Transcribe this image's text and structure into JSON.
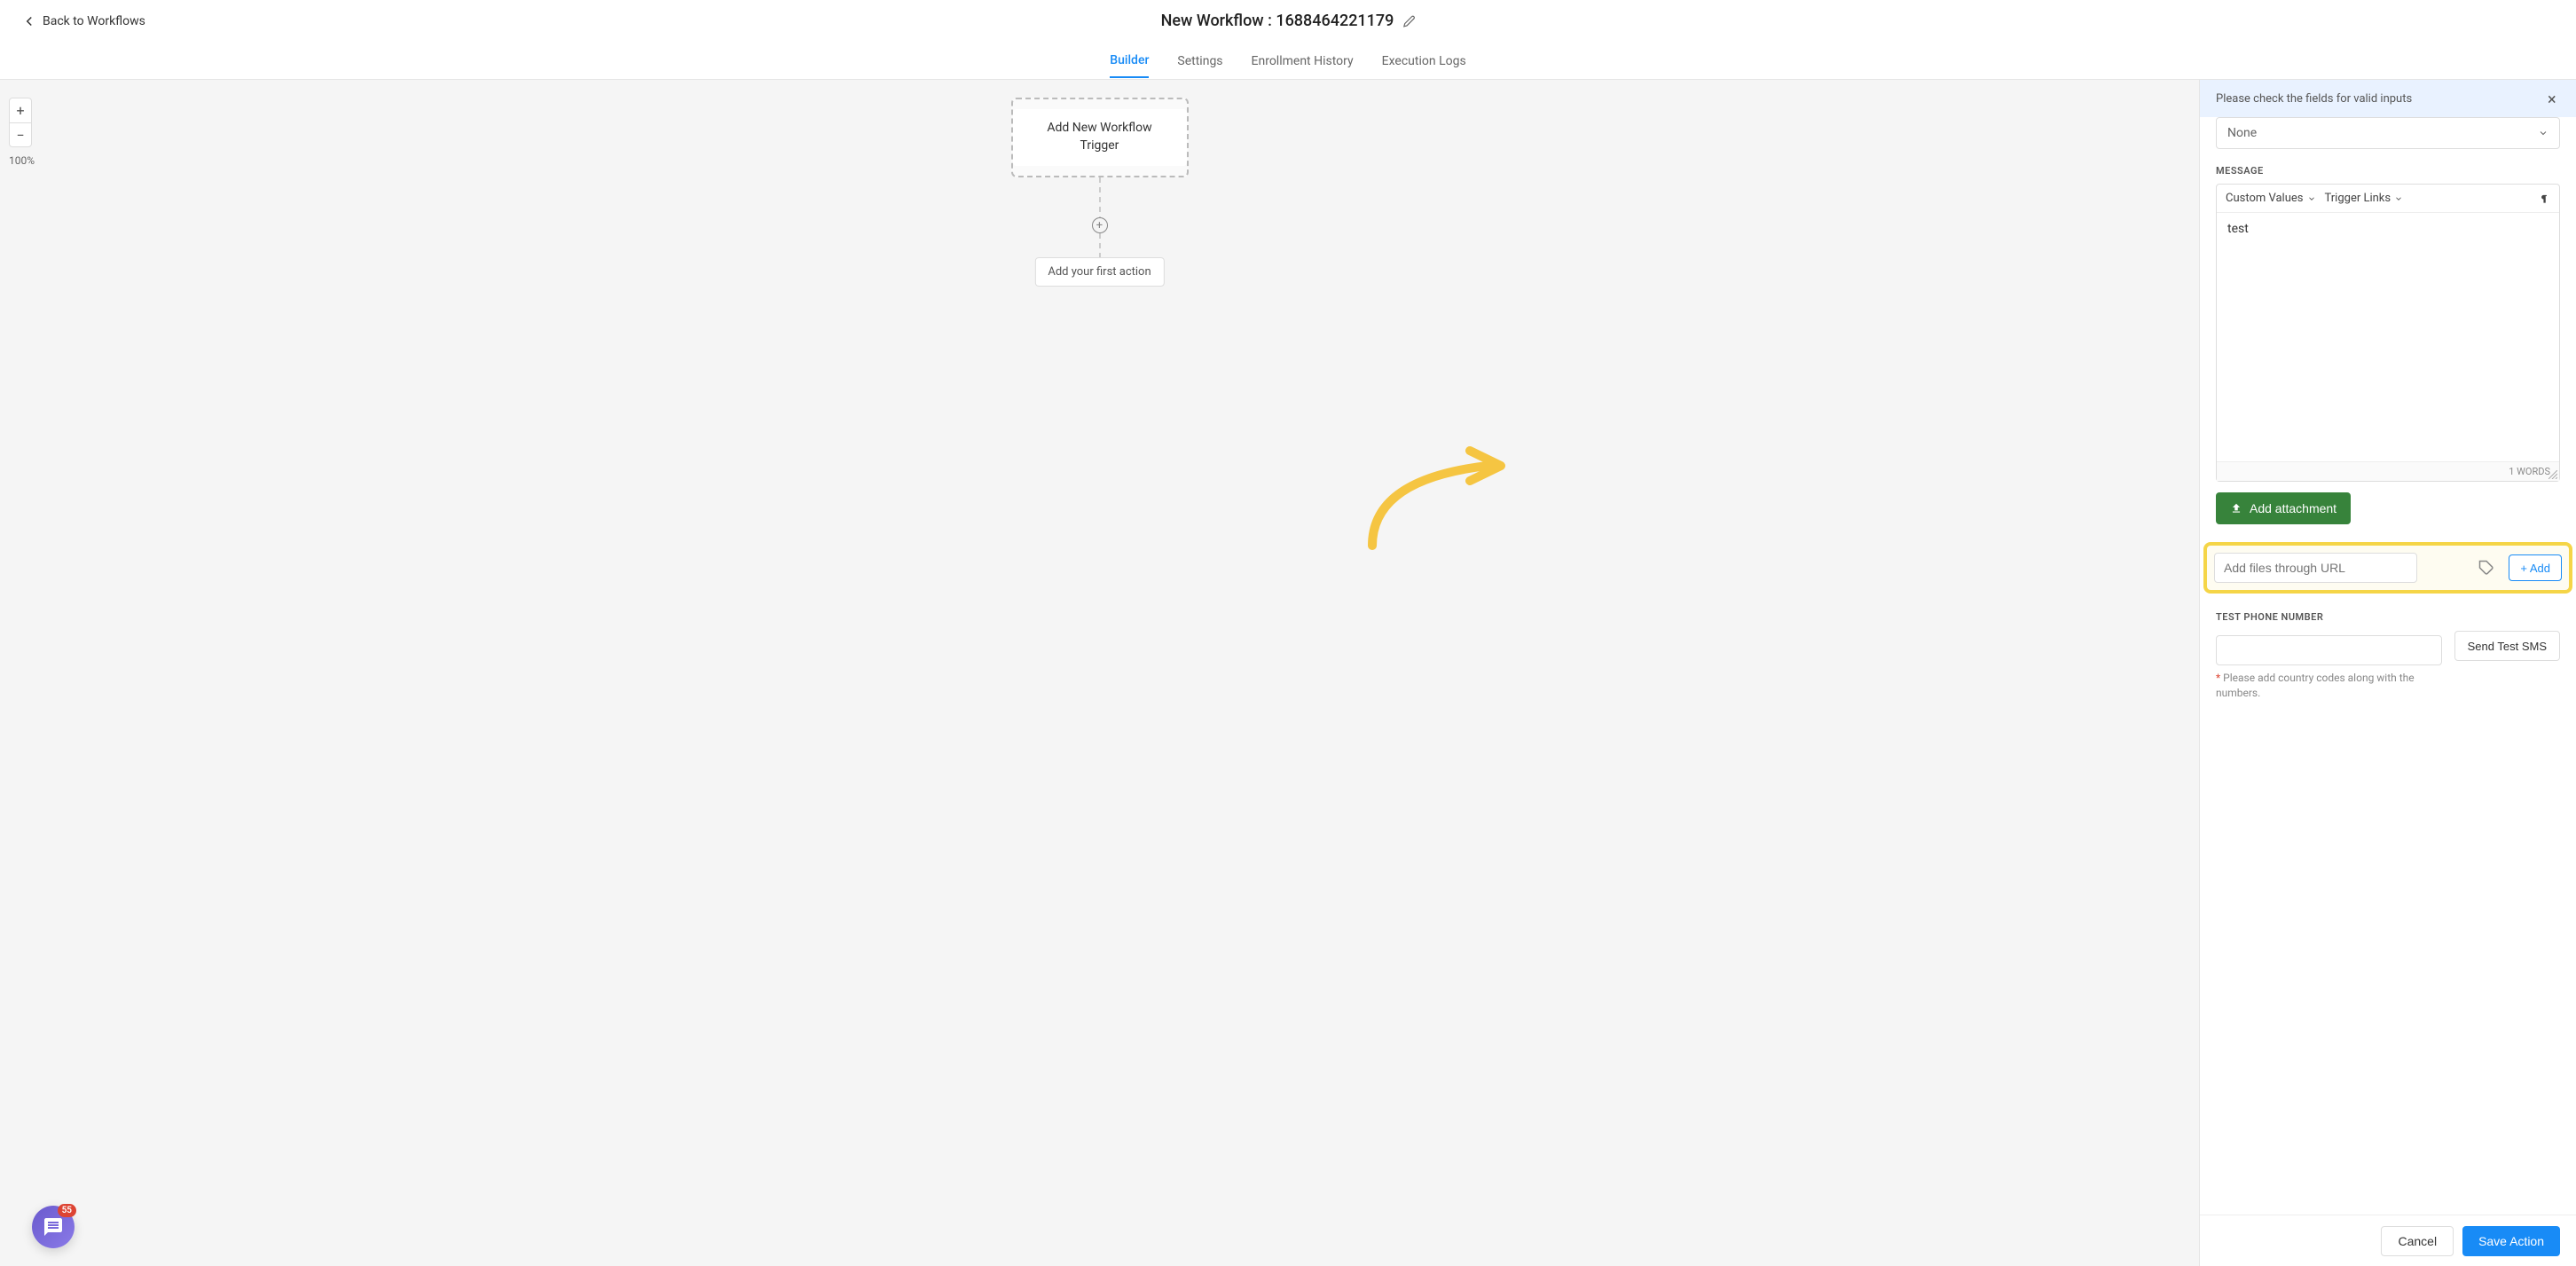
{
  "header": {
    "back_label": "Back to Workflows",
    "title": "New Workflow : 1688464221179"
  },
  "tabs": {
    "builder": "Builder",
    "settings": "Settings",
    "enrollment": "Enrollment History",
    "execution": "Execution Logs"
  },
  "canvas": {
    "zoom_pct": "100%",
    "trigger_label": "Add New Workflow Trigger",
    "first_action_label": "Add your first action"
  },
  "panel": {
    "alert_text": "Please check the fields for valid inputs",
    "select_value": "None",
    "message_label": "MESSAGE",
    "toolbar_custom": "Custom Values",
    "toolbar_trigger": "Trigger Links",
    "editor_text": "test",
    "word_count": "1 WORDS",
    "attach_label": "Add attachment",
    "url_placeholder": "Add files through URL",
    "url_add_label": "+ Add",
    "test_label": "TEST PHONE NUMBER",
    "send_label": "Send Test SMS",
    "help_text": "Please add country codes along with the numbers.",
    "cancel_label": "Cancel",
    "save_label": "Save Action"
  },
  "chat": {
    "badge": "55"
  }
}
